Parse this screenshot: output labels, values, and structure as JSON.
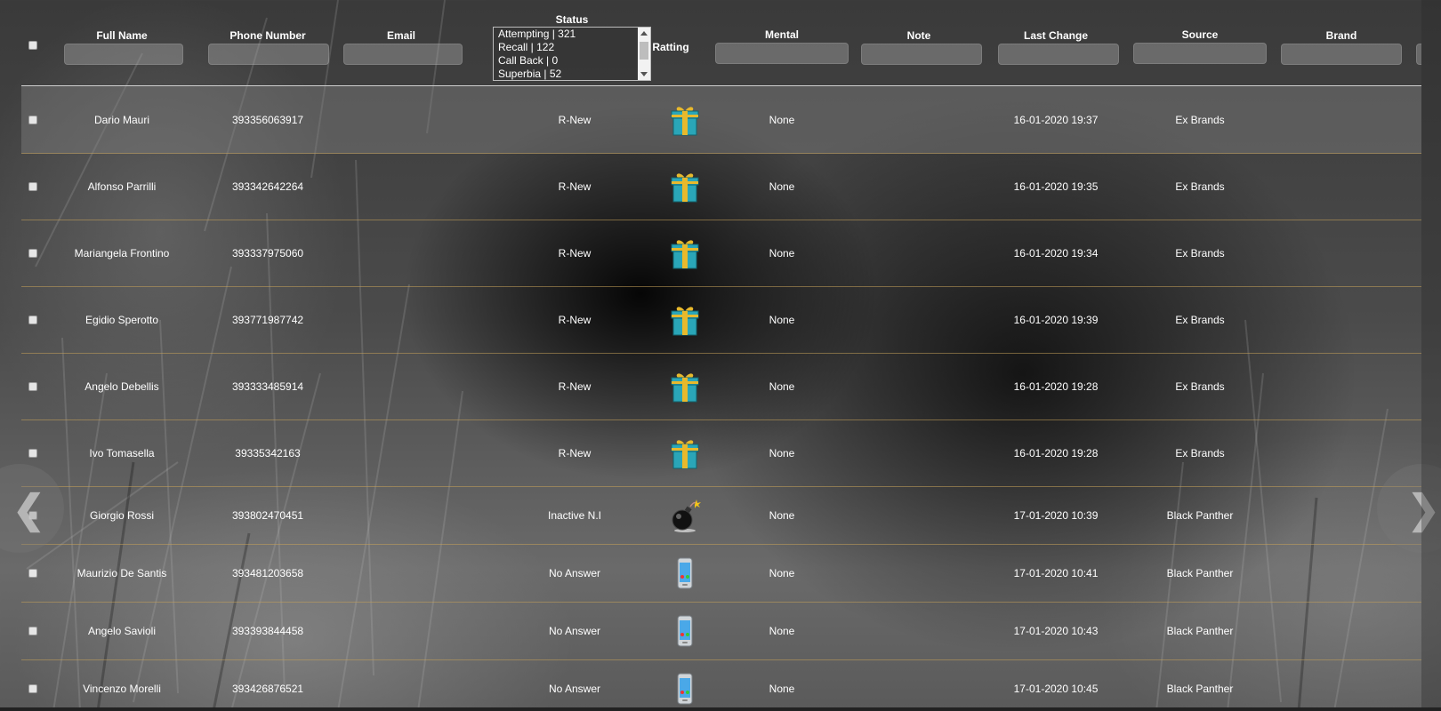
{
  "table": {
    "columns": [
      {
        "key": "full_name",
        "label": "Full Name"
      },
      {
        "key": "phone",
        "label": "Phone Number"
      },
      {
        "key": "email",
        "label": "Email"
      },
      {
        "key": "status",
        "label": "Status"
      },
      {
        "key": "rating",
        "label": "Ratting"
      },
      {
        "key": "mental",
        "label": "Mental"
      },
      {
        "key": "note",
        "label": "Note"
      },
      {
        "key": "last_change",
        "label": "Last Change"
      },
      {
        "key": "source",
        "label": "Source"
      },
      {
        "key": "brand",
        "label": "Brand"
      }
    ],
    "status_filter_options": [
      "Attempting | 321",
      "Recall | 122",
      "Call Back | 0",
      "Superbia | 52"
    ],
    "rows": [
      {
        "name": "Dario Mauri",
        "phone": "393356063917",
        "status": "R-New",
        "rating_icon": "gift-icon",
        "mental": "None",
        "last_change": "16-01-2020 19:37",
        "source": "Ex Brands"
      },
      {
        "name": "Alfonso Parrilli",
        "phone": "393342642264",
        "status": "R-New",
        "rating_icon": "gift-icon",
        "mental": "None",
        "last_change": "16-01-2020 19:35",
        "source": "Ex Brands"
      },
      {
        "name": "Mariangela Frontino",
        "phone": "393337975060",
        "status": "R-New",
        "rating_icon": "gift-icon",
        "mental": "None",
        "last_change": "16-01-2020 19:34",
        "source": "Ex Brands"
      },
      {
        "name": "Egidio Sperotto",
        "phone": "393771987742",
        "status": "R-New",
        "rating_icon": "gift-icon",
        "mental": "None",
        "last_change": "16-01-2020 19:39",
        "source": "Ex Brands"
      },
      {
        "name": "Angelo Debellis",
        "phone": "393333485914",
        "status": "R-New",
        "rating_icon": "gift-icon",
        "mental": "None",
        "last_change": "16-01-2020 19:28",
        "source": "Ex Brands"
      },
      {
        "name": "Ivo Tomasella",
        "phone": "39335342163",
        "status": "R-New",
        "rating_icon": "gift-icon",
        "mental": "None",
        "last_change": "16-01-2020 19:28",
        "source": "Ex Brands"
      },
      {
        "name": "Giorgio Rossi",
        "phone": "393802470451",
        "status": "Inactive N.I",
        "rating_icon": "bomb-icon",
        "mental": "None",
        "last_change": "17-01-2020 10:39",
        "source": "Black Panther"
      },
      {
        "name": "Maurizio De Santis",
        "phone": "393481203658",
        "status": "No Answer",
        "rating_icon": "phone-icon",
        "mental": "None",
        "last_change": "17-01-2020 10:41",
        "source": "Black Panther"
      },
      {
        "name": "Angelo Savioli",
        "phone": "393393844458",
        "status": "No Answer",
        "rating_icon": "phone-icon",
        "mental": "None",
        "last_change": "17-01-2020 10:43",
        "source": "Black Panther"
      },
      {
        "name": "Vincenzo Morelli",
        "phone": "393426876521",
        "status": "No Answer",
        "rating_icon": "phone-icon",
        "mental": "None",
        "last_change": "17-01-2020 10:45",
        "source": "Black Panther"
      }
    ]
  },
  "navigation": {
    "prev_icon": "chevron-left-icon",
    "next_icon": "chevron-right-icon",
    "prev_glyph": "❮",
    "next_glyph": "❯"
  },
  "colors": {
    "row_divider": "#c4a05a",
    "header_divider": "#cfcfcf",
    "gift_box": "#2aa6b8",
    "gift_ribbon": "#e8b92c",
    "phone_screen": "#4aa8e8"
  }
}
